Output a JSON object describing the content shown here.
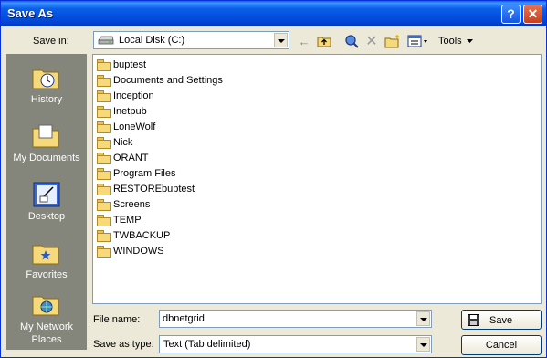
{
  "window": {
    "title": "Save As"
  },
  "toolbar": {
    "save_in_label": "Save in:",
    "location": "Local Disk (C:)",
    "tools_label": "Tools"
  },
  "places": [
    {
      "label": "History",
      "icon": "history-icon"
    },
    {
      "label": "My Documents",
      "icon": "my-documents-icon"
    },
    {
      "label": "Desktop",
      "icon": "desktop-icon"
    },
    {
      "label": "Favorites",
      "icon": "favorites-icon"
    },
    {
      "label": "My Network Places",
      "icon": "network-places-icon"
    }
  ],
  "files": [
    "buptest",
    "Documents and Settings",
    "Inception",
    "Inetpub",
    "LoneWolf",
    "Nick",
    "ORANT",
    "Program Files",
    "RESTOREbuptest",
    "Screens",
    "TEMP",
    "TWBACKUP",
    "WINDOWS"
  ],
  "form": {
    "filename_label": "File name:",
    "filename_value": "dbnetgrid",
    "type_label": "Save as type:",
    "type_value": "Text (Tab delimited)"
  },
  "buttons": {
    "save": "Save",
    "cancel": "Cancel"
  }
}
